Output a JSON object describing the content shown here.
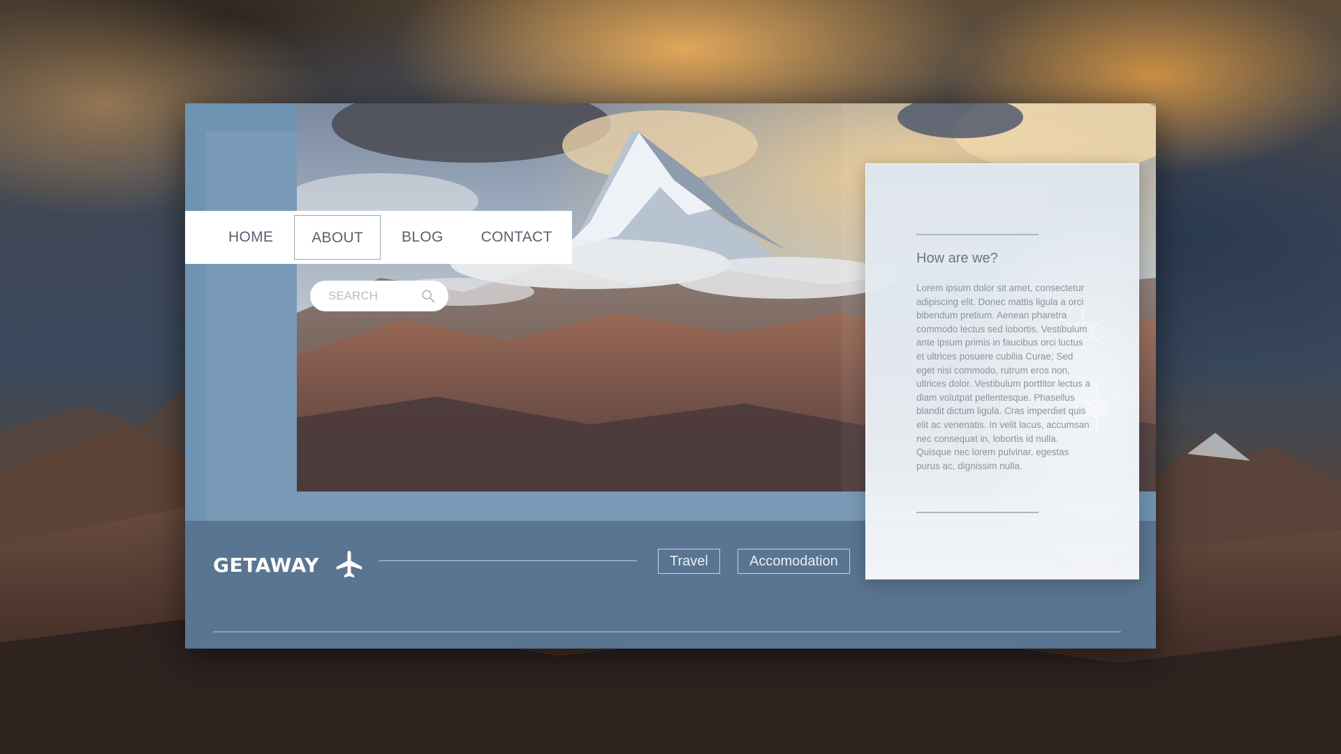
{
  "nav": {
    "items": [
      {
        "label": "HOME",
        "active": false
      },
      {
        "label": "ABOUT",
        "active": true
      },
      {
        "label": "BLOG",
        "active": false
      },
      {
        "label": "CONTACT",
        "active": false
      }
    ]
  },
  "search": {
    "placeholder": "SEARCH",
    "icon": "search-icon"
  },
  "brand": {
    "name": "GETAWAY",
    "icon": "airplane-icon"
  },
  "footer": {
    "buttons": [
      "Travel",
      "Accomodation"
    ]
  },
  "info_card": {
    "title": "How are we?",
    "body": "Lorem ipsum dolor sit amet, consectetur adipiscing elit. Donec mattis ligula a orci bibendum pretium. Aenean pharetra commodo lectus sed lobortis. Vestibulum ante ipsum primis in faucibus orci luctus et ultrices posuere cubilia Curae; Sed eget nisi commodo, rutrum eros non, ultrices dolor. Vestibulum porttitor lectus a diam volutpat pellentesque. Phasellus blandit dictum ligula. Cras imperdiet quis elit ac venenatis. In velit lacus, accumsan nec consequat in, lobortis id nulla. Quisque nec lorem pulvinar, egestas purus ac, dignissim nulla."
  },
  "colors": {
    "card_blue": "#6f93b2",
    "footer_blue": "#5a7591",
    "nav_text": "#56616e",
    "white": "#ffffff"
  }
}
